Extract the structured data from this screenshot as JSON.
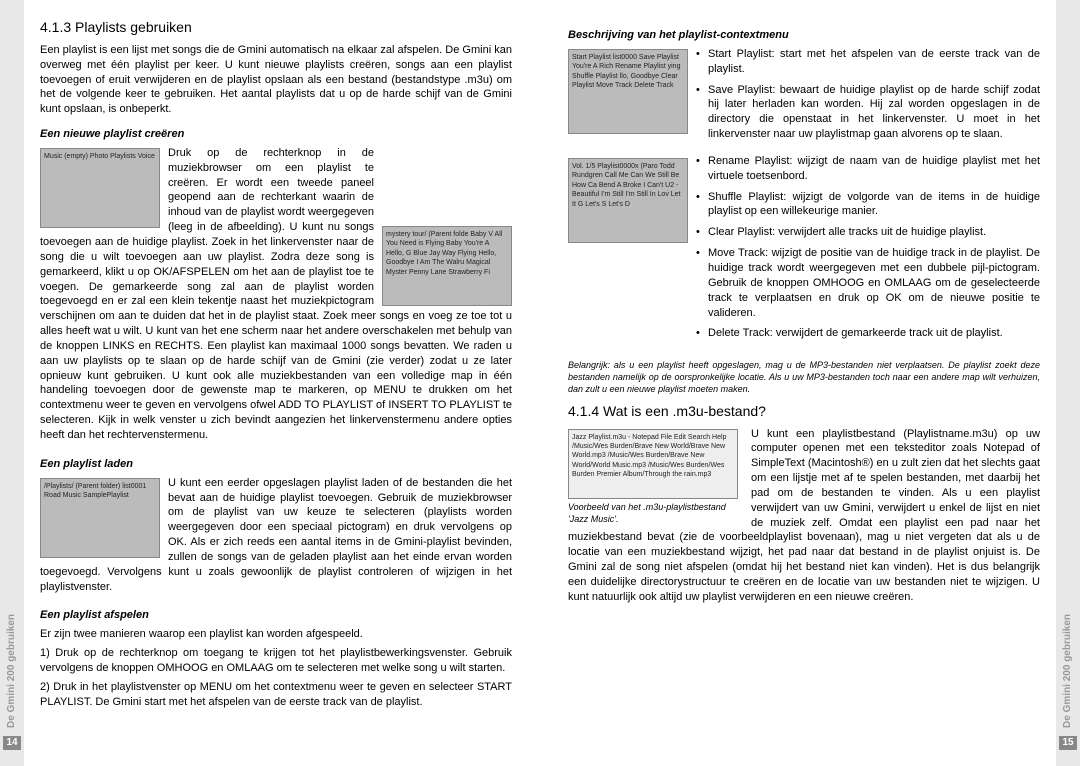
{
  "left": {
    "h_413": "4.1.3 Playlists gebruiken",
    "p_intro": "Een playlist is een lijst met songs die de Gmini automatisch na elkaar zal afspelen. De Gmini kan overweg met één playlist per keer. U kunt nieuwe playlists creëren, songs aan een playlist toevoegen of eruit verwijderen en de playlist opslaan als een bestand (bestandstype .m3u) om het de volgende keer te gebruiken. Het aantal playlists dat u op de harde schijf van de Gmini kunt opslaan, is onbeperkt.",
    "h_create": "Een nieuwe playlist creëren",
    "p_create": "Druk op de rechterknop in de muziekbrowser om een playlist te creëren. Er wordt een tweede paneel geopend aan de rechterkant waarin de inhoud van de playlist wordt weergegeven (leeg in de afbeelding). U kunt nu songs toevoegen aan de huidige playlist. Zoek in het linkervenster naar de song die u wilt toevoegen aan uw playlist. Zodra deze song is gemarkeerd, klikt u op OK/AFSPELEN om het aan de playlist toe te voegen. De gemarkeerde song zal aan de playlist worden toegevoegd en er zal een klein tekentje naast het muziekpictogram verschijnen om aan te duiden dat het in de playlist staat. Zoek meer songs en voeg ze toe tot u alles heeft wat u wilt. U kunt van het ene scherm naar het andere overschakelen met behulp van de knoppen LINKS en RECHTS. Een playlist kan maximaal 1000 songs bevatten. We raden u aan uw playlists op te slaan op de harde schijf van de Gmini (zie verder) zodat u ze later opnieuw kunt gebruiken. U kunt ook alle muziekbestanden van een volledige map in één handeling toevoegen door de gewenste map te markeren, op MENU te drukken om het contextmenu weer te geven en vervolgens ofwel ADD TO PLAYLIST of INSERT TO PLAYLIST te selecteren. Kijk in welk venster u zich bevindt aangezien het linkervenstermenu andere opties heeft dan het rechtervenstermenu.",
    "h_load": "Een playlist laden",
    "p_load": "U kunt een eerder opgeslagen playlist laden of de bestanden die het bevat aan de huidige playlist toevoegen. Gebruik de muziekbrowser om de playlist van uw keuze te selecteren (playlists worden weergegeven door een speciaal pictogram) en druk vervolgens op OK. Als er zich reeds een aantal items in de Gmini-playlist bevinden, zullen de songs van de geladen playlist aan het einde ervan worden toegevoegd. Vervolgens kunt u zoals gewoonlijk de playlist controleren of wijzigen in het playlistvenster.",
    "h_play": "Een playlist afspelen",
    "p_play_intro": "Er zijn twee manieren waarop een playlist kan worden afgespeeld.",
    "p_play_1": "1) Druk op de rechterknop om toegang te krijgen tot het playlistbewerkingsvenster. Gebruik vervolgens de knoppen OMHOOG en OMLAAG om te selecteren met welke song u wilt starten.",
    "p_play_2": "2) Druk in het playlistvenster op MENU om het contextmenu weer te geven en selecteer START PLAYLIST. De Gmini start met het afspelen van de eerste track van de playlist.",
    "thumb1": "Music (empty)\nPhoto\nPlaylists\nVoice",
    "thumb2": "mystery tour/\n(Parent folde  Baby V\nAll You Need is  Flying\nBaby You're A   Hello, G\nBlue Jay Way\nFlying\nHello, Goodbye\nI Am The Walru\nMagical Myster\nPenny Lane\nStrawberry Fi",
    "thumb3": "/Playlists/\n(Parent folder)\nlist0001\nRoad Music\nSamplePlaylist"
  },
  "right": {
    "h_context": "Beschrijving van het playlist-contextmenu",
    "thumb4": "Start Playlist  list0000\nSave Playlist  You're A Rich\nRename Playlist  ying\nShuffle Playlist  llo, Goodbye\nClear Playlist\nMove Track\nDelete Track",
    "thumb5": "Vol. 1/5  Playlist0000x\n(Paro  Todd Rundgren\nCall Me  Can We Still Be\nHow Ca   Bend A Broke\nI Can't   U2 - Beautiful\nI'm Still  I'm Still In Lov\nLet It G\nLet's S\nLet's D",
    "li_start": "Start Playlist: start met het afspelen van de eerste track van de playlist.",
    "li_save": "Save Playlist: bewaart de huidige playlist op de harde schijf zodat hij later herladen kan worden. Hij zal worden opgeslagen in de directory die openstaat in het linkervenster. U moet in het linkervenster naar uw playlistmap gaan alvorens op te slaan.",
    "li_rename": "Rename Playlist: wijzigt de naam van de huidige playlist met het virtuele toetsenbord.",
    "li_shuffle": "Shuffle Playlist: wijzigt de volgorde van de items in de huidige playlist op een willekeurige manier.",
    "li_clear": "Clear Playlist: verwijdert alle tracks uit de huidige playlist.",
    "li_move": "Move Track: wijzigt de positie van de huidige track in de playlist. De huidige track wordt weergegeven met een dubbele pijl-pictogram. Gebruik de knoppen OMHOOG en OMLAAG om de geselecteerde track te verplaatsen en druk op OK om de nieuwe positie te valideren.",
    "li_delete": "Delete Track: verwijdert de gemarkeerde track uit de playlist.",
    "note": "Belangrijk: als u een playlist heeft opgeslagen, mag u de MP3-bestanden niet verplaatsen. De playlist zoekt deze bestanden namelijk op de oorspronkelijke locatie. Als u uw MP3-bestanden toch naar een andere map wilt verhuizen, dan zult u een nieuwe playlist moeten maken.",
    "h_414": "4.1.4 Wat is een .m3u-bestand?",
    "thumb6": "Jazz Playlist.m3u - Notepad\nFile Edit Search Help\n/Music/Wes Burden/Brave New World/Brave New World.mp3\n/Music/Wes Burden/Brave New World/World Music.mp3\n/Music/Wes Burden/Wes Burden Premier Album/Through the rain.mp3",
    "caption6": "Voorbeeld van het .m3u-playlistbestand 'Jazz Music'.",
    "p_m3u": "U kunt een playlistbestand (Playlistname.m3u) op uw computer openen met een teksteditor zoals Notepad of SimpleText (Macintosh®) en u zult zien dat het slechts gaat om een lijstje met af te spelen bestanden, met daarbij het pad om de bestanden te vinden. Als u een playlist verwijdert van uw Gmini, verwijdert u enkel de lijst en niet de muziek zelf. Omdat een playlist een pad naar het muziekbestand bevat (zie de voorbeeldplaylist bovenaan), mag u niet vergeten dat als u de locatie van een muziekbestand wijzigt, het pad naar dat bestand in de playlist onjuist is. De Gmini zal de song niet afspelen (omdat hij het bestand niet kan vinden). Het is dus belangrijk een duidelijke directorystructuur te creëren en de locatie van uw bestanden niet te wijzigen. U kunt natuurlijk ook altijd uw playlist verwijderen en een nieuwe creëren."
  },
  "sidebar": {
    "label": "De Gmini 200 gebruiken",
    "page_left": "14",
    "page_right": "15"
  }
}
